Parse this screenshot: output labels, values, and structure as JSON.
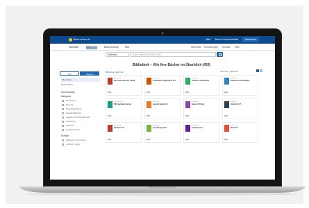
{
  "topbar": {
    "brand": "Beck-online.de",
    "items": [
      "Hilfe",
      "Mein Konto",
      "Merkliste"
    ],
    "cart_label": "Warenkorb"
  },
  "nav": {
    "items": [
      "Startseite",
      "Bibliothek",
      "Beck-eLibrary",
      "Neu"
    ],
    "active_index": 1,
    "right_items": [
      "Abmelden",
      "Einstellungen",
      "Kontakt",
      "Hilfe"
    ]
  },
  "search": {
    "select_value": "Bibliothek",
    "placeholder": "Suche nach Titel, Autor, ISBN ..."
  },
  "page_title": "Bibliothek – Alle Ihre Bücher im Überblick (439)",
  "results": {
    "label": "Sortieren: Relevanz"
  },
  "sidebar": {
    "tabs": [
      "Titel",
      "Themen"
    ],
    "links": [
      "Alle Inhalte",
      "Meine Bücher"
    ],
    "filter_head": "Ihre Auswahl",
    "category_head": "Kategorie",
    "categories": [
      "Arbeitsrecht",
      "Baurecht",
      "Bürgerliches Recht",
      "Gesellschaftsrecht",
      "Handels- und Wirtschaftsrecht",
      "Steuerrecht",
      "Strafrecht",
      "Verfassungsrecht"
    ],
    "format_head": "Format",
    "formats": [
      "Handbuch / Kommentar",
      "Lehrbuch / Skript"
    ]
  },
  "breadcrumb": "Bibliothek › Alle Titel",
  "products": [
    {
      "meta": "Handbuch",
      "title": "Das neue Recht der GmbH",
      "price": "2022",
      "color": "#c0392b"
    },
    {
      "meta": "Kommentar",
      "title": "Schuldrecht Allgemeiner Teil",
      "price": "2023",
      "color": "#d35400"
    },
    {
      "meta": "Lehrbuch",
      "title": "Arbeitsrecht Kompakt",
      "price": "2023",
      "color": "#27ae60"
    },
    {
      "meta": "Handbuch",
      "title": "Steuerrecht Grundlagen",
      "price": "2021",
      "color": "#2e86c1"
    },
    {
      "meta": "Kommentar",
      "title": "BGB Handkommentar",
      "price": "2022",
      "color": "#16a085"
    },
    {
      "meta": "Lehrbuch",
      "title": "Gesellschaftsrecht",
      "price": "2022",
      "color": "#e67e22"
    },
    {
      "meta": "Handbuch",
      "title": "Baurecht Praxis",
      "price": "2023",
      "color": "#8e44ad"
    },
    {
      "meta": "Lehrbuch",
      "title": "Strafrecht AT",
      "price": "2022",
      "color": "#2c3e50"
    },
    {
      "meta": "Kommentar",
      "title": "Handelsrecht",
      "price": "2021",
      "color": "#c0392b"
    },
    {
      "meta": "Handbuch",
      "title": "Verwaltungsrecht",
      "price": "2023",
      "color": "#7cb342"
    },
    {
      "meta": "Lehrbuch",
      "title": "Familienrecht",
      "price": "2022",
      "color": "#6a1b9a"
    },
    {
      "meta": "Kommentar",
      "title": "Mietrecht",
      "price": "2021",
      "color": "#e74c3c"
    }
  ]
}
